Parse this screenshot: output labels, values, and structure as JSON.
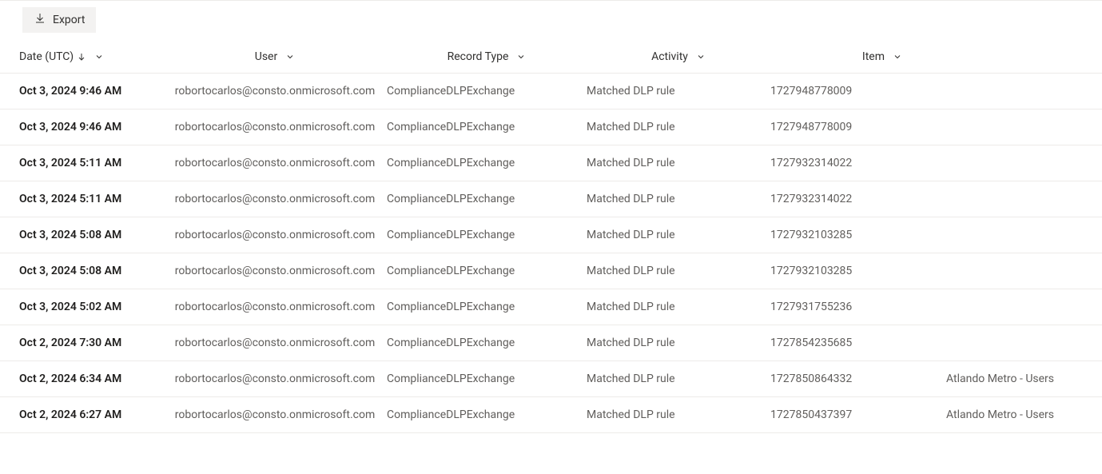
{
  "toolbar": {
    "export_label": "Export"
  },
  "table": {
    "headers": {
      "date": "Date (UTC)",
      "user": "User",
      "record_type": "Record Type",
      "activity": "Activity",
      "item": "Item"
    },
    "rows": [
      {
        "date": "Oct 3, 2024 9:46 AM",
        "user": "robortocarlos@consto.onmicrosoft.com",
        "record_type": "ComplianceDLPExchange",
        "activity": "Matched DLP rule",
        "item": "1727948778009",
        "extra": ""
      },
      {
        "date": "Oct 3, 2024 9:46 AM",
        "user": "robortocarlos@consto.onmicrosoft.com",
        "record_type": "ComplianceDLPExchange",
        "activity": "Matched DLP rule",
        "item": "1727948778009",
        "extra": ""
      },
      {
        "date": "Oct 3, 2024 5:11 AM",
        "user": "robortocarlos@consto.onmicrosoft.com",
        "record_type": "ComplianceDLPExchange",
        "activity": "Matched DLP rule",
        "item": "1727932314022",
        "extra": ""
      },
      {
        "date": "Oct 3, 2024 5:11 AM",
        "user": "robortocarlos@consto.onmicrosoft.com",
        "record_type": "ComplianceDLPExchange",
        "activity": "Matched DLP rule",
        "item": "1727932314022",
        "extra": ""
      },
      {
        "date": "Oct 3, 2024 5:08 AM",
        "user": "robortocarlos@consto.onmicrosoft.com",
        "record_type": "ComplianceDLPExchange",
        "activity": "Matched DLP rule",
        "item": "1727932103285",
        "extra": ""
      },
      {
        "date": "Oct 3, 2024 5:08 AM",
        "user": "robortocarlos@consto.onmicrosoft.com",
        "record_type": "ComplianceDLPExchange",
        "activity": "Matched DLP rule",
        "item": "1727932103285",
        "extra": ""
      },
      {
        "date": "Oct 3, 2024 5:02 AM",
        "user": "robortocarlos@consto.onmicrosoft.com",
        "record_type": "ComplianceDLPExchange",
        "activity": "Matched DLP rule",
        "item": "1727931755236",
        "extra": ""
      },
      {
        "date": "Oct 2, 2024 7:30 AM",
        "user": "robortocarlos@consto.onmicrosoft.com",
        "record_type": "ComplianceDLPExchange",
        "activity": "Matched DLP rule",
        "item": "1727854235685",
        "extra": ""
      },
      {
        "date": "Oct 2, 2024 6:34 AM",
        "user": "robortocarlos@consto.onmicrosoft.com",
        "record_type": "ComplianceDLPExchange",
        "activity": "Matched DLP rule",
        "item": "1727850864332",
        "extra": "Atlando Metro - Users"
      },
      {
        "date": "Oct 2, 2024 6:27 AM",
        "user": "robortocarlos@consto.onmicrosoft.com",
        "record_type": "ComplianceDLPExchange",
        "activity": "Matched DLP rule",
        "item": "1727850437397",
        "extra": "Atlando Metro - Users"
      }
    ]
  }
}
